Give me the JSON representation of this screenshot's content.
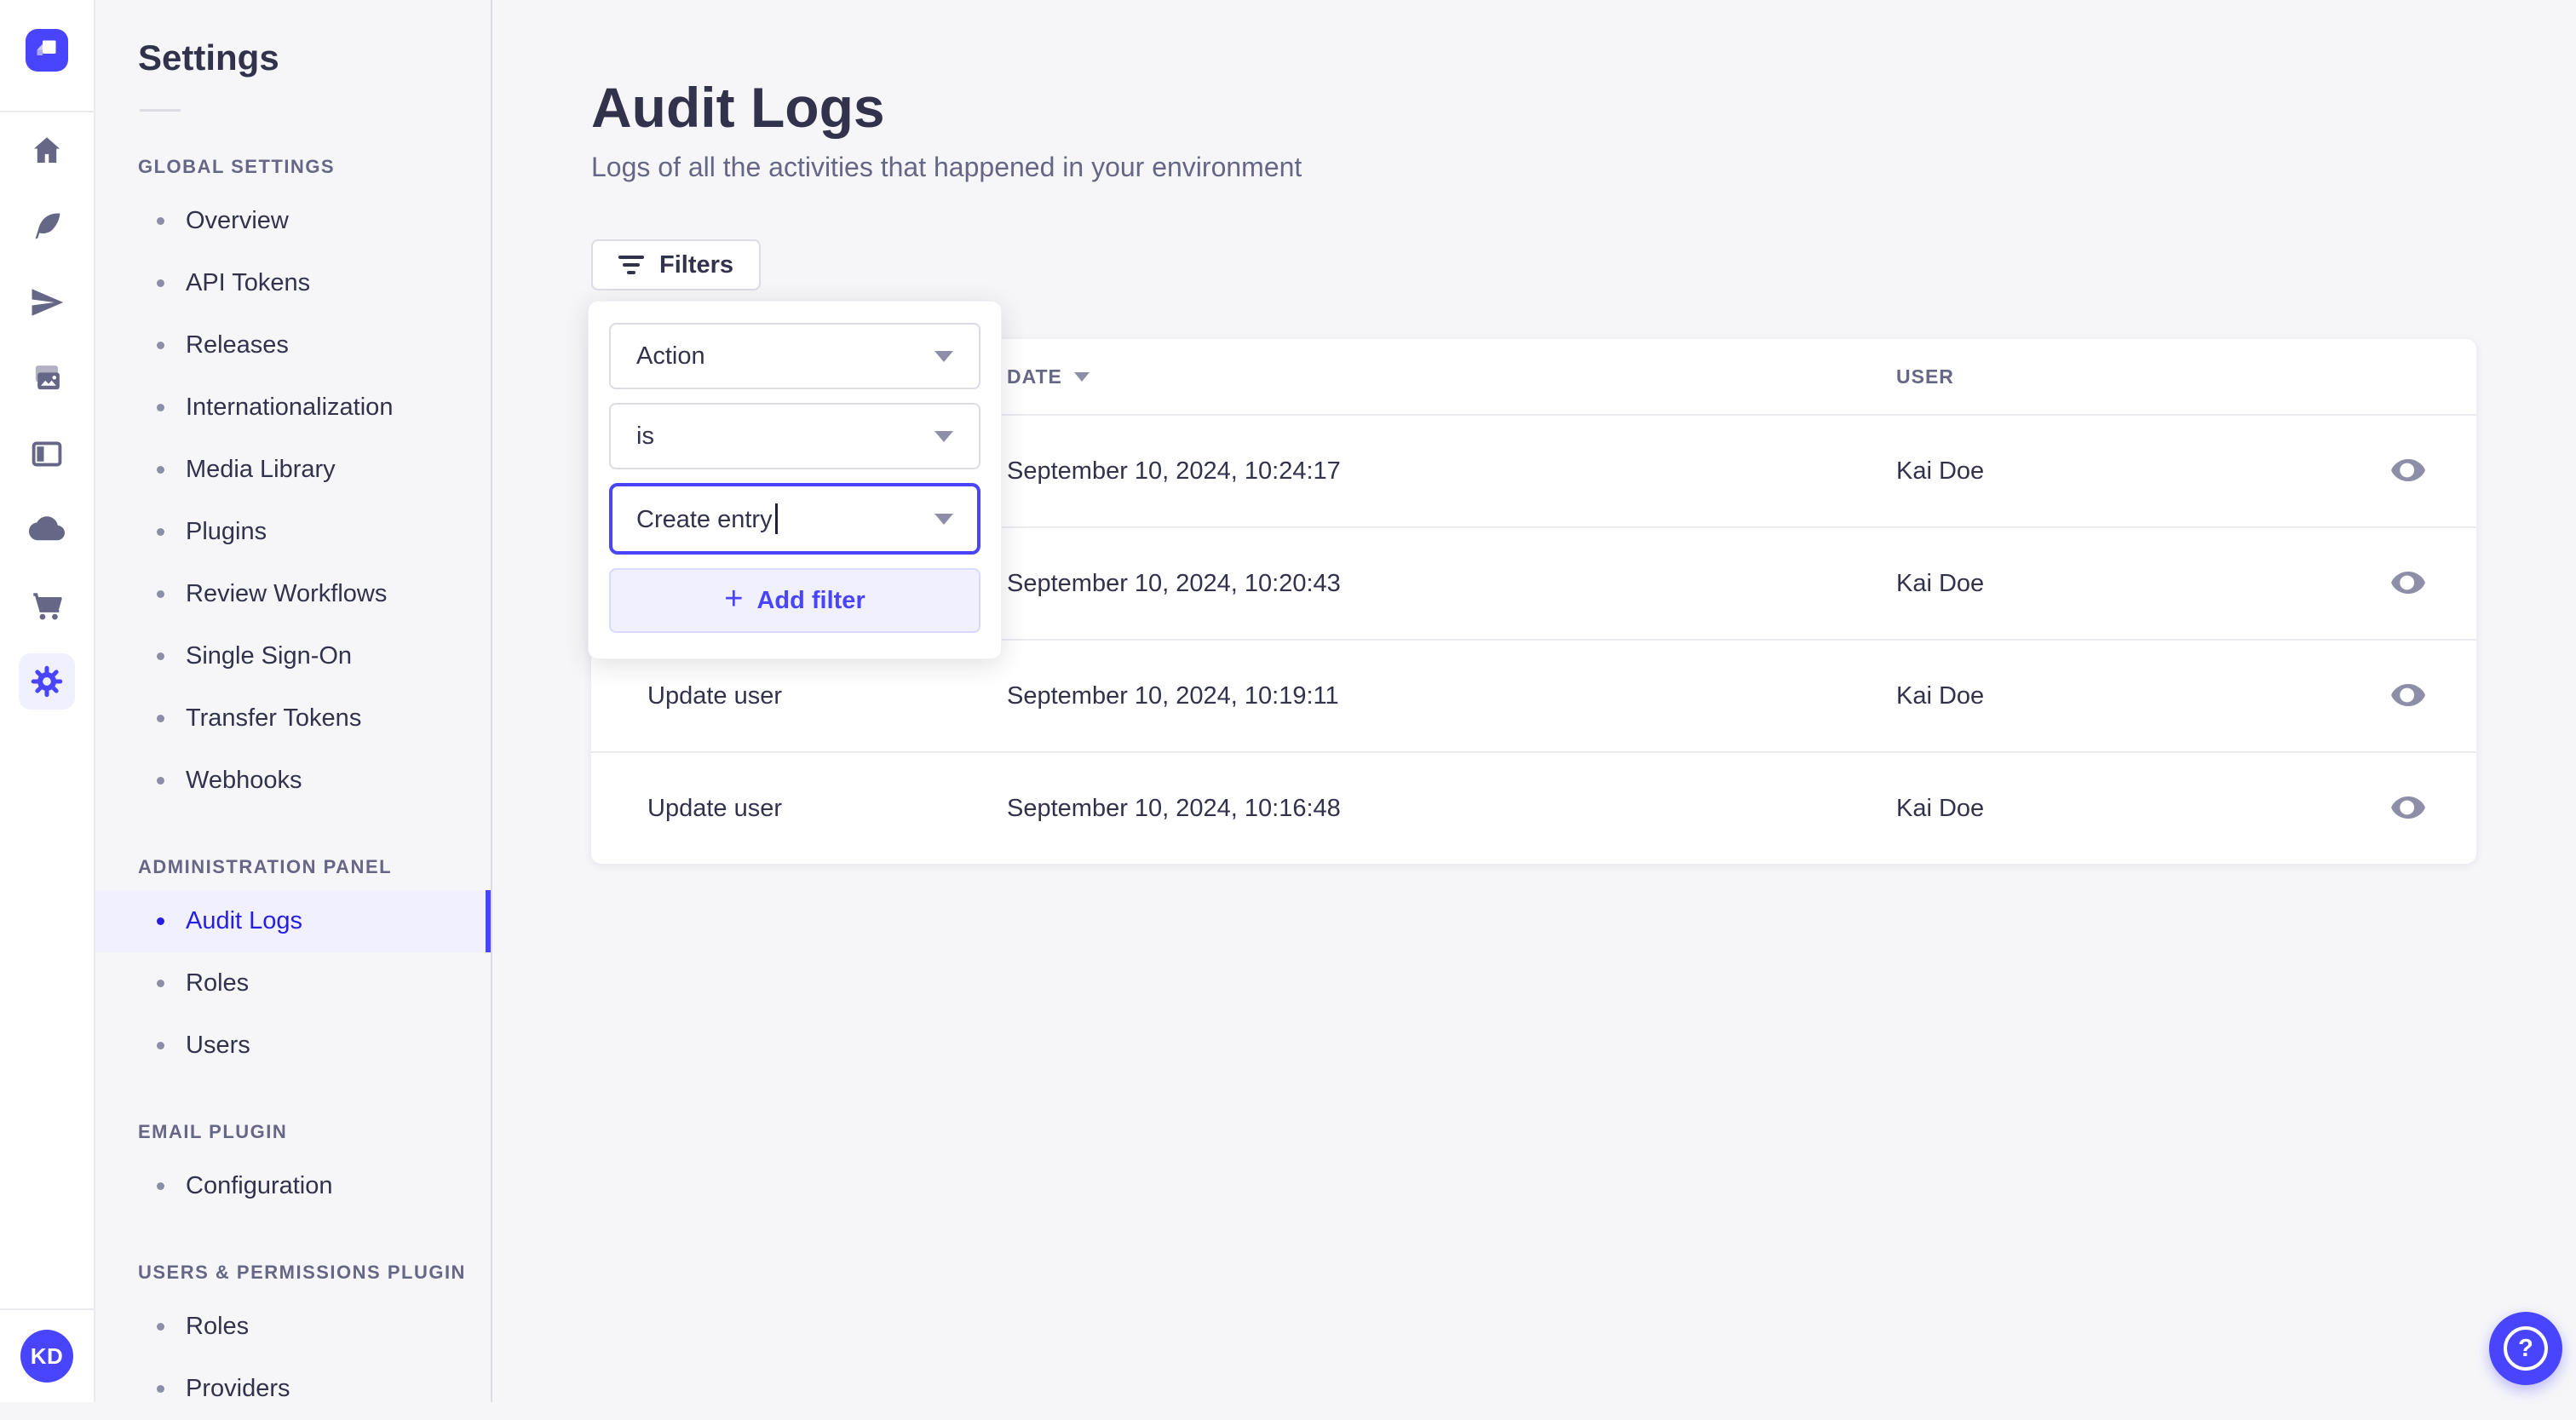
{
  "colors": {
    "accent": "#4945FF",
    "accent_dark": "#271FE0",
    "accent_light_bg": "#F0F0FF",
    "text_primary": "#32324D",
    "text_secondary": "#666687",
    "border": "#DCDCE4",
    "page_bg": "#F6F6F9"
  },
  "icon_strip": {
    "avatar_initials": "KD"
  },
  "settings_nav": {
    "title": "Settings",
    "sections": [
      {
        "label": "GLOBAL SETTINGS",
        "items": [
          "Overview",
          "API Tokens",
          "Releases",
          "Internationalization",
          "Media Library",
          "Plugins",
          "Review Workflows",
          "Single Sign-On",
          "Transfer Tokens",
          "Webhooks"
        ]
      },
      {
        "label": "ADMINISTRATION PANEL",
        "items": [
          "Audit Logs",
          "Roles",
          "Users"
        ],
        "active_item": "Audit Logs"
      },
      {
        "label": "EMAIL PLUGIN",
        "items": [
          "Configuration"
        ]
      },
      {
        "label": "USERS & PERMISSIONS PLUGIN",
        "items": [
          "Roles",
          "Providers"
        ]
      }
    ]
  },
  "page": {
    "title": "Audit Logs",
    "subtitle": "Logs of all the activities that happened in your environment"
  },
  "filters": {
    "button_label": "Filters",
    "popover": {
      "field_value": "Action",
      "operator_value": "is",
      "value_value": "Create entry",
      "plus_glyph": "+",
      "add_filter_label": "Add filter"
    }
  },
  "table": {
    "headers": {
      "action": "",
      "date": "DATE",
      "user": "USER"
    },
    "rows": [
      {
        "action": "",
        "date": "September 10, 2024, 10:24:17",
        "user": "Kai Doe"
      },
      {
        "action": "",
        "date": "September 10, 2024, 10:20:43",
        "user": "Kai Doe"
      },
      {
        "action": "Update user",
        "date": "September 10, 2024, 10:19:11",
        "user": "Kai Doe"
      },
      {
        "action": "Update user",
        "date": "September 10, 2024, 10:16:48",
        "user": "Kai Doe"
      }
    ]
  },
  "help": {
    "glyph": "?"
  }
}
